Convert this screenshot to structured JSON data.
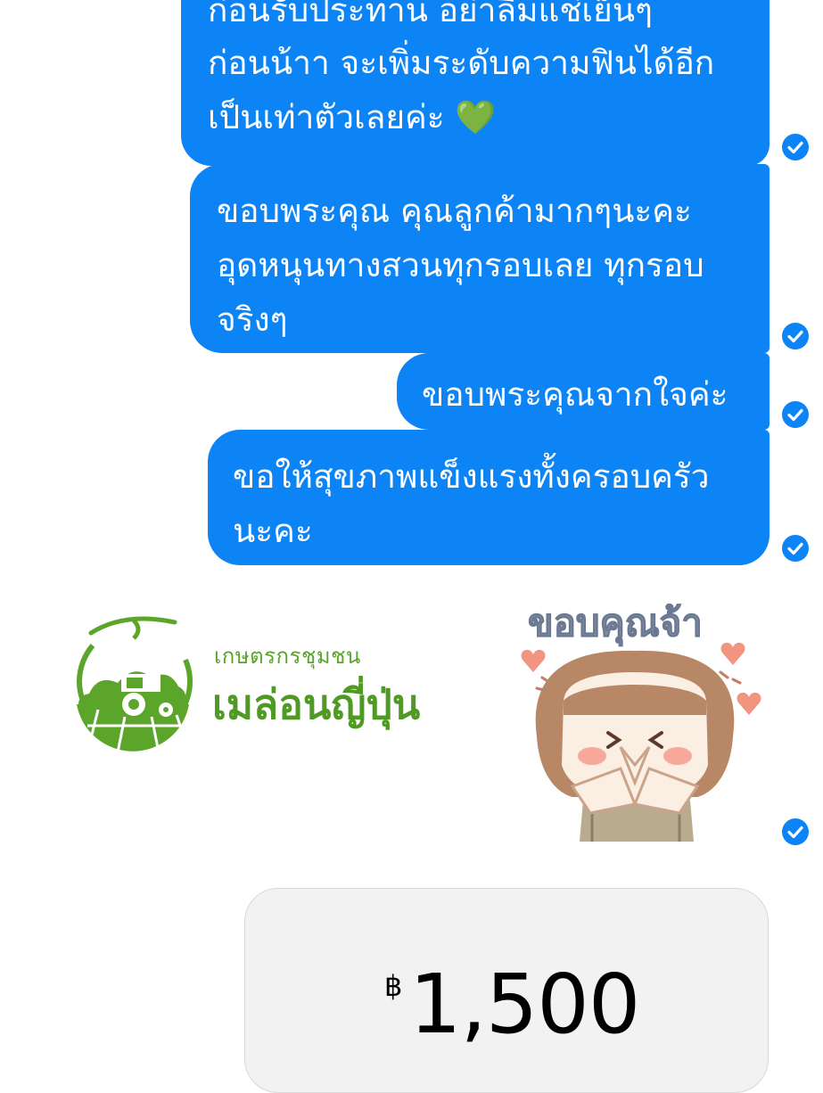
{
  "messages": [
    {
      "lines": [
        "ก่อนรับประทาน อย่าลืมแช่เย็นๆ",
        "ก่อนน้าา จะเพิ่มระดับความฟินได้อีก",
        "เป็นเท่าตัวเลยค่ะ 💚"
      ],
      "status": "seen"
    },
    {
      "lines": [
        "ขอบพระคุณ คุณลูกค้ามากๆนะคะ",
        "อุดหนุนทางสวนทุกรอบเลย ทุกรอบ",
        "จริงๆ"
      ],
      "status": "seen"
    },
    {
      "lines": [
        "ขอบพระคุณจากใจค่ะ"
      ],
      "status": "seen"
    },
    {
      "lines": [
        "ขอให้สุขภาพแข็งแรงทั้งครอบครัว",
        "นะคะ"
      ],
      "status": "seen"
    }
  ],
  "logo": {
    "line1": "เกษตรกรชุมชน",
    "line2": "เมล่อนญี่ปุ่น",
    "color": "#4e9a22"
  },
  "sticker": {
    "text": "ขอบคุณจ้า",
    "status": "seen"
  },
  "payment": {
    "currency": "฿",
    "amount": "1,500"
  },
  "colors": {
    "bubble": "#0d84f5",
    "card": "#f2f2f3"
  },
  "icons": {
    "status": "check-circle-icon"
  }
}
